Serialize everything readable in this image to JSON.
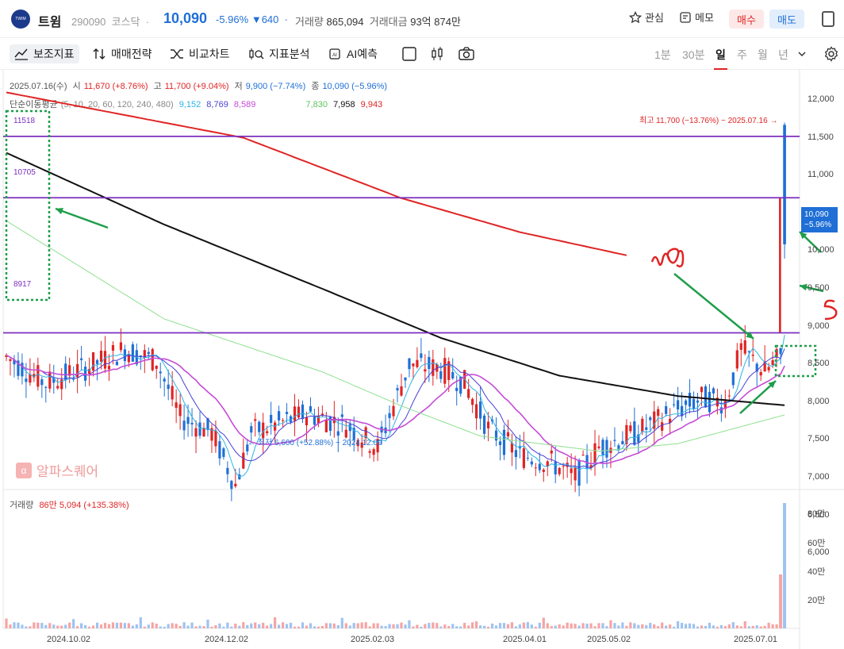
{
  "header": {
    "logo_text": "TWIM",
    "name": "트윔",
    "code": "290090",
    "market": "코스닥",
    "price": "10,090",
    "change_pct": "-5.96%",
    "change_arrow": "▼",
    "change_abs": "640",
    "volume_label": "거래량",
    "volume": "865,094",
    "turnover_label": "거래대금",
    "turnover": "93억 874만",
    "watch_label": "관심",
    "memo_label": "메모",
    "buy_label": "매수",
    "sell_label": "매도"
  },
  "toolbar": {
    "indicator_label": "보조지표",
    "strategy_label": "매매전략",
    "compare_label": "비교차트",
    "analysis_label": "지표분석",
    "ai_label": "AI예측",
    "periods": [
      "1분",
      "30분",
      "일",
      "주",
      "월",
      "년"
    ],
    "selected_period": "일"
  },
  "legend": {
    "date": "2025.07.16(수)",
    "open_label": "시",
    "open": "11,670 (+8.76%)",
    "high_label": "고",
    "high": "11,700 (+9.04%)",
    "low_label": "저",
    "low": "9,900 (−7.74%)",
    "close_label": "종",
    "close": "10,090 (−5.96%)",
    "ma_label": "단순이동평균",
    "ma_periods": "(5, 10, 20, 60, 120, 240, 480)",
    "ma_values": [
      "9,152",
      "8,769",
      "8,589",
      "7,830",
      "7,958",
      "9,943"
    ]
  },
  "chart_data": {
    "type": "candlestick",
    "y_axis_ticks": [
      "12,000",
      "11,500",
      "11,000",
      "10,500",
      "10,000",
      "9,500",
      "9,000",
      "8,500",
      "8,000",
      "7,500",
      "7,000",
      "6,500",
      "6,000"
    ],
    "ylim": [
      6000,
      12000
    ],
    "x_axis_ticks": [
      "2024.10.02",
      "2024.12.02",
      "2025.02.03",
      "2025.04.01",
      "2025.05.02",
      "2025.07.01"
    ],
    "horizontal_levels": [
      "11518",
      "10705",
      "8917"
    ],
    "max_annotation": "최고 11,700 (−13.76%) − 2025.07.16",
    "min_annotation": "최저 6,600 (+52.88%) − 2024.12.09",
    "current_price": "10,090",
    "current_change": "−5.96%",
    "watermark": "알파스퀘어",
    "volume_panel": {
      "label": "거래량",
      "value": "86만 5,094 (+135.38%)",
      "ticks": [
        "80만",
        "60만",
        "40만",
        "20만"
      ]
    }
  },
  "colors": {
    "up": "#e02424",
    "down": "#1f6fd6",
    "level_line": "#7b2fbf",
    "ma120": "#111111",
    "ma240": "#e02424",
    "ma60": "#8fe08f",
    "ma20": "#c54bd6",
    "annotation_green": "#1e9e4a"
  }
}
